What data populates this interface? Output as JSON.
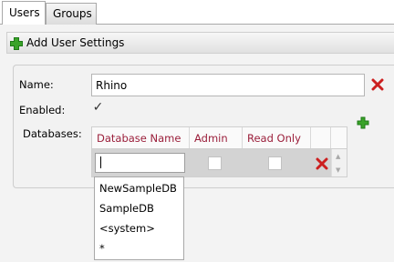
{
  "tabs": [
    {
      "label": "Users",
      "active": true
    },
    {
      "label": "Groups",
      "active": false
    }
  ],
  "panel": {
    "header_title": "Add User Settings",
    "header_icon": "plus-icon"
  },
  "form": {
    "name_label": "Name:",
    "name_value": "Rhino",
    "enabled_label": "Enabled:",
    "enabled_checked": true,
    "enabled_glyph": "✓",
    "databases_label": "Databases:"
  },
  "grid": {
    "columns": [
      "Database Name",
      "Admin",
      "Read Only"
    ],
    "row": {
      "database_name": "",
      "admin": false,
      "read_only": false
    }
  },
  "dropdown": {
    "options": [
      "NewSampleDB",
      "SampleDB",
      "<system>",
      "*"
    ]
  },
  "colors": {
    "header_text": "#9b1f3b",
    "add_icon": "#3aa329",
    "remove_icon": "#cc1f1f",
    "row_background": "#d3d3d3"
  }
}
